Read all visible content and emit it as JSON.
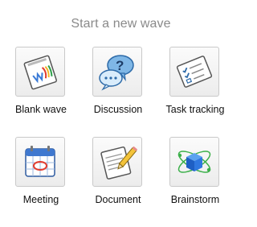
{
  "header": {
    "title": "Start a new wave"
  },
  "tiles": [
    {
      "label": "Blank wave",
      "icon": "blank-wave-icon"
    },
    {
      "label": "Discussion",
      "icon": "discussion-icon"
    },
    {
      "label": "Task tracking",
      "icon": "task-tracking-icon"
    },
    {
      "label": "Meeting",
      "icon": "meeting-icon"
    },
    {
      "label": "Document",
      "icon": "document-icon"
    },
    {
      "label": "Brainstorm",
      "icon": "brainstorm-icon"
    }
  ]
}
